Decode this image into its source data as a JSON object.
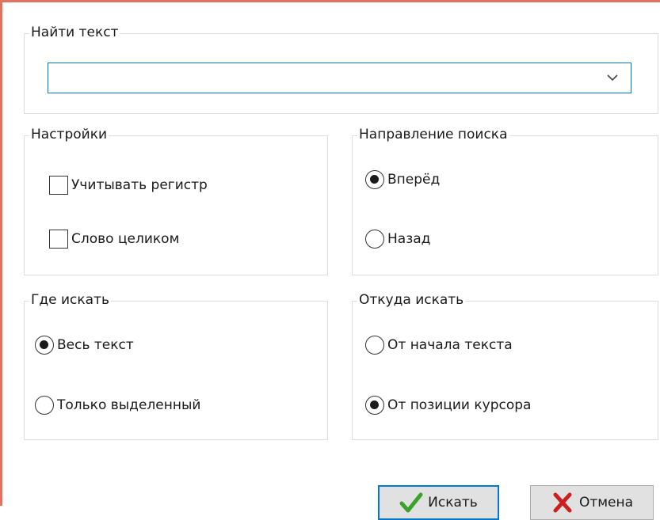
{
  "find": {
    "title": "Найти текст",
    "value": ""
  },
  "settings": {
    "title": "Настройки",
    "match_case": "Учитывать регистр",
    "whole_word": "Слово целиком"
  },
  "direction": {
    "title": "Направление поиска",
    "forward": "Вперёд",
    "backward": "Назад",
    "selected": "forward"
  },
  "scope": {
    "title": "Где искать",
    "all_text": "Весь текст",
    "selection_only": "Только выделенный",
    "selected": "all_text"
  },
  "origin": {
    "title": "Откуда искать",
    "from_start": "От начала текста",
    "from_cursor": "От позиции курсора",
    "selected": "from_cursor"
  },
  "buttons": {
    "search": "Искать",
    "cancel": "Отмена"
  },
  "colors": {
    "accent": "#0078d7",
    "frame": "#e0735d",
    "check_green": "#3aa12a",
    "cancel_red": "#cc1f1f"
  }
}
